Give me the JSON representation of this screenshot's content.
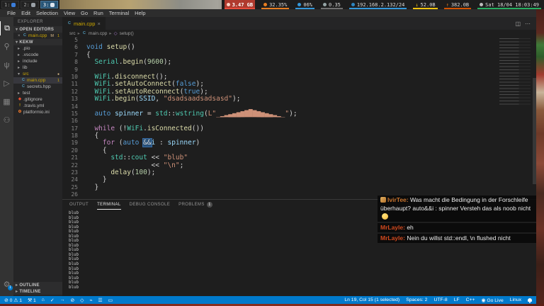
{
  "topbar": {
    "workspaces": [
      {
        "label": "1:",
        "icon": "globe-icon",
        "icon_color": "#3b7dd8",
        "active": false
      },
      {
        "label": "2:",
        "icon": "monitor-icon",
        "icon_color": "#9aa0a6",
        "active": false
      },
      {
        "label": "3:",
        "icon": "document-icon",
        "icon_color": "#dce4ee",
        "active": true
      }
    ],
    "blocks": [
      {
        "text": "3.47 GB",
        "icon": "memory-icon",
        "icon_color": "#ffd2c4",
        "underline": "#e74c3c",
        "bg": "#b03a2e",
        "alert": true
      },
      {
        "text": "32.35%",
        "icon": "cpu-icon",
        "icon_color": "#e67e22",
        "underline": "#e67e22"
      },
      {
        "text": "06%",
        "icon": "temp-icon",
        "icon_color": "#3498db",
        "underline": "#3498db"
      },
      {
        "text": "0.35",
        "icon": "load-gear-icon",
        "icon_color": "#95a5a6",
        "underline": "#707070"
      },
      {
        "text": "192.168.2.132/24",
        "icon": "network-icon",
        "icon_color": "#2e86c1",
        "underline": "#3498db"
      },
      {
        "text": "52.0B",
        "icon": "download-arrow-icon",
        "icon_color": "#f1c40f",
        "underline": "#f1c40f",
        "glyph": "↓"
      },
      {
        "text": "382.0B",
        "icon": "upload-arrow-icon",
        "icon_color": "#e67e22",
        "underline": "#d35400",
        "glyph": "↑"
      },
      {
        "text": "Sat 18/04 18:03:49",
        "icon": "clock-icon",
        "icon_color": "#bdbdbd",
        "underline": "#27ae60"
      }
    ]
  },
  "menubar": {
    "items": [
      "File",
      "Edit",
      "Selection",
      "View",
      "Go",
      "Run",
      "Terminal",
      "Help"
    ]
  },
  "activity_bar": {
    "top": [
      {
        "name": "explorer-icon",
        "glyph": "⧉",
        "active": true
      },
      {
        "name": "search-icon",
        "glyph": "⚲",
        "active": false
      },
      {
        "name": "source-control-icon",
        "glyph": "ψ",
        "active": false
      },
      {
        "name": "run-debug-icon",
        "glyph": "▷",
        "active": false
      },
      {
        "name": "extensions-icon",
        "glyph": "▦",
        "active": false
      },
      {
        "name": "platformio-icon",
        "glyph": "⚇",
        "active": false
      }
    ],
    "bottom": [
      {
        "name": "manage-gear-icon",
        "glyph": "⚙",
        "badge": "1"
      }
    ]
  },
  "sidebar": {
    "title": "EXPLORER",
    "open_editors_label": "OPEN EDITORS",
    "open_editors": [
      {
        "file": "main.cpp",
        "git": "M",
        "badge": "1"
      }
    ],
    "workspace_label": "KEKW",
    "files": [
      {
        "label": ".pio",
        "type": "folder",
        "chev": "▸"
      },
      {
        "label": ".vscode",
        "type": "folder",
        "chev": "▸"
      },
      {
        "label": "include",
        "type": "folder",
        "chev": "▸"
      },
      {
        "label": "lib",
        "type": "folder",
        "chev": "▸"
      },
      {
        "label": "src",
        "type": "folder",
        "chev": "▾",
        "warn": true,
        "dot": "●"
      },
      {
        "label": "main.cpp",
        "type": "cpp",
        "indent": 1,
        "active": true,
        "warn": true,
        "badge": "1"
      },
      {
        "label": "secrets.hpp",
        "type": "cpp",
        "indent": 1
      },
      {
        "label": "test",
        "type": "folder",
        "chev": "▸"
      },
      {
        "label": ".gitignore",
        "type": "git"
      },
      {
        "label": ".travis.yml",
        "type": "yml"
      },
      {
        "label": "platformio.ini",
        "type": "ini"
      }
    ],
    "outline_label": "OUTLINE",
    "timeline_label": "TIMELINE"
  },
  "editor": {
    "tab": {
      "file": "main.cpp",
      "close": "×"
    },
    "actions": {
      "split": "◫",
      "more": "⋯"
    },
    "breadcrumb": [
      {
        "label": "src",
        "icon": ""
      },
      {
        "label": "main.cpp",
        "icon": "cpp"
      },
      {
        "label": "setup()",
        "icon": "method"
      }
    ],
    "code": [
      {
        "n": "5",
        "parts": []
      },
      {
        "n": "6",
        "parts": [
          [
            "kw",
            "void"
          ],
          [
            "pl",
            " "
          ],
          [
            "fn",
            "setup"
          ],
          [
            "pl",
            "()"
          ]
        ]
      },
      {
        "n": "7",
        "parts": [
          [
            "pl",
            "{"
          ]
        ]
      },
      {
        "n": "8",
        "parts": [
          [
            "pl",
            "  "
          ],
          [
            "typ",
            "Serial"
          ],
          [
            "pl",
            "."
          ],
          [
            "fn",
            "begin"
          ],
          [
            "pl",
            "("
          ],
          [
            "num",
            "9600"
          ],
          [
            "pl",
            ");"
          ]
        ]
      },
      {
        "n": "9",
        "parts": []
      },
      {
        "n": "10",
        "parts": [
          [
            "pl",
            "  "
          ],
          [
            "typ",
            "WiFi"
          ],
          [
            "pl",
            "."
          ],
          [
            "fn",
            "disconnect"
          ],
          [
            "pl",
            "();"
          ]
        ]
      },
      {
        "n": "11",
        "parts": [
          [
            "pl",
            "  "
          ],
          [
            "typ",
            "WiFi"
          ],
          [
            "pl",
            "."
          ],
          [
            "fn",
            "setAutoConnect"
          ],
          [
            "pl",
            "("
          ],
          [
            "kw",
            "false"
          ],
          [
            "pl",
            ");"
          ]
        ]
      },
      {
        "n": "12",
        "parts": [
          [
            "pl",
            "  "
          ],
          [
            "typ",
            "WiFi"
          ],
          [
            "pl",
            "."
          ],
          [
            "fn",
            "setAutoReconnect"
          ],
          [
            "pl",
            "("
          ],
          [
            "kw",
            "true"
          ],
          [
            "pl",
            ");"
          ]
        ]
      },
      {
        "n": "13",
        "parts": [
          [
            "pl",
            "  "
          ],
          [
            "typ",
            "WiFi"
          ],
          [
            "pl",
            "."
          ],
          [
            "fn",
            "begin"
          ],
          [
            "pl",
            "("
          ],
          [
            "var",
            "SSID"
          ],
          [
            "pl",
            ", "
          ],
          [
            "str",
            "\"dsadsaadsadsasd\""
          ],
          [
            "pl",
            ");"
          ]
        ]
      },
      {
        "n": "14",
        "parts": []
      },
      {
        "n": "15",
        "parts": [
          [
            "pl",
            "  "
          ],
          [
            "kw",
            "auto"
          ],
          [
            "pl",
            " "
          ],
          [
            "var",
            "spinner"
          ],
          [
            "pl",
            " = "
          ],
          [
            "typ",
            "std"
          ],
          [
            "pl",
            "::"
          ],
          [
            "typ",
            "wstring"
          ],
          [
            "pl",
            "("
          ],
          [
            "str",
            "L\"_▁▂▃▄▅▆▇█▇▆▅▄▃▂▁_\""
          ],
          [
            "pl",
            ");"
          ]
        ]
      },
      {
        "n": "16",
        "parts": []
      },
      {
        "n": "17",
        "parts": [
          [
            "pl",
            "  "
          ],
          [
            "ctl",
            "while"
          ],
          [
            "pl",
            " (!"
          ],
          [
            "typ",
            "WiFi"
          ],
          [
            "pl",
            "."
          ],
          [
            "fn",
            "isConnected"
          ],
          [
            "pl",
            "())"
          ]
        ]
      },
      {
        "n": "18",
        "parts": [
          [
            "pl",
            "  {"
          ]
        ]
      },
      {
        "n": "19",
        "parts": [
          [
            "pl",
            "    "
          ],
          [
            "ctl",
            "for"
          ],
          [
            "pl",
            " ("
          ],
          [
            "kw",
            "auto"
          ],
          [
            "pl",
            " "
          ],
          [
            "sel",
            "&&"
          ],
          [
            "var",
            "i"
          ],
          [
            "pl",
            " : "
          ],
          [
            "var",
            "spinner"
          ],
          [
            "pl",
            ")"
          ]
        ]
      },
      {
        "n": "20",
        "parts": [
          [
            "pl",
            "    {"
          ]
        ]
      },
      {
        "n": "21",
        "parts": [
          [
            "pl",
            "      "
          ],
          [
            "typ",
            "std"
          ],
          [
            "pl",
            "::"
          ],
          [
            "typ",
            "cout"
          ],
          [
            "pl",
            " << "
          ],
          [
            "str",
            "\"blub\""
          ]
        ]
      },
      {
        "n": "22",
        "parts": [
          [
            "pl",
            "                << "
          ],
          [
            "str",
            "\"\\n\""
          ],
          [
            "pl",
            ";"
          ]
        ]
      },
      {
        "n": "23",
        "parts": [
          [
            "pl",
            "      "
          ],
          [
            "fn",
            "delay"
          ],
          [
            "pl",
            "("
          ],
          [
            "num",
            "100"
          ],
          [
            "pl",
            ");"
          ]
        ]
      },
      {
        "n": "24",
        "parts": [
          [
            "pl",
            "    }"
          ]
        ]
      },
      {
        "n": "25",
        "parts": [
          [
            "pl",
            "  }"
          ]
        ]
      },
      {
        "n": "26",
        "parts": []
      }
    ]
  },
  "panel": {
    "tabs": [
      {
        "label": "OUTPUT",
        "active": false
      },
      {
        "label": "TERMINAL",
        "active": true
      },
      {
        "label": "DEBUG CONSOLE",
        "active": false
      },
      {
        "label": "PROBLEMS",
        "active": false,
        "badge": "1"
      }
    ],
    "terminal_lines": [
      "blub",
      "blub",
      "blub",
      "blub",
      "blub",
      "blub",
      "blub",
      "blub",
      "blub",
      "blub",
      "blub",
      "blub",
      "blub",
      "blub",
      "blub",
      "blub",
      "blub"
    ]
  },
  "chat": {
    "messages": [
      {
        "badge": true,
        "user": "IvirTee",
        "user_color": "#c9742e",
        "text": "Was macht die Bedingung in der Forschleife überhaupt? auto&&i : spinner Versteh das als noob nicht",
        "emote": "sweat-smile-emote"
      },
      {
        "badge": false,
        "user": "MrLayle",
        "user_color": "#d2491e",
        "text": "eh"
      },
      {
        "badge": false,
        "user": "MrLayle",
        "user_color": "#d2491e",
        "text": "Nein du willst std::endl, \\n flushed nicht"
      }
    ]
  },
  "statusbar": {
    "left": [
      {
        "name": "problems-status",
        "text": "⊘ 0  ⚠ 1"
      },
      {
        "name": "pio-env-status",
        "text": "⚒ 1"
      },
      {
        "name": "pio-home-icon",
        "text": "⌂"
      },
      {
        "name": "pio-build-icon",
        "text": "✓"
      },
      {
        "name": "pio-upload-icon",
        "text": "→"
      },
      {
        "name": "pio-clean-icon",
        "text": "⊘"
      },
      {
        "name": "pio-test-icon",
        "text": "◇"
      },
      {
        "name": "pio-serial-monitor-icon",
        "text": "⌁"
      },
      {
        "name": "pio-tasks-icon",
        "text": "☰"
      },
      {
        "name": "pio-terminal-icon",
        "text": "▭"
      }
    ],
    "right": [
      {
        "name": "cursor-position",
        "text": "Ln 19, Col 15 (1 selected)"
      },
      {
        "name": "indentation",
        "text": "Spaces: 2"
      },
      {
        "name": "encoding",
        "text": "UTF-8"
      },
      {
        "name": "eol",
        "text": "LF"
      },
      {
        "name": "language-mode",
        "text": "C++"
      },
      {
        "name": "go-live",
        "text": "◉ Go Live"
      },
      {
        "name": "remote-os",
        "text": "Linux"
      }
    ]
  }
}
